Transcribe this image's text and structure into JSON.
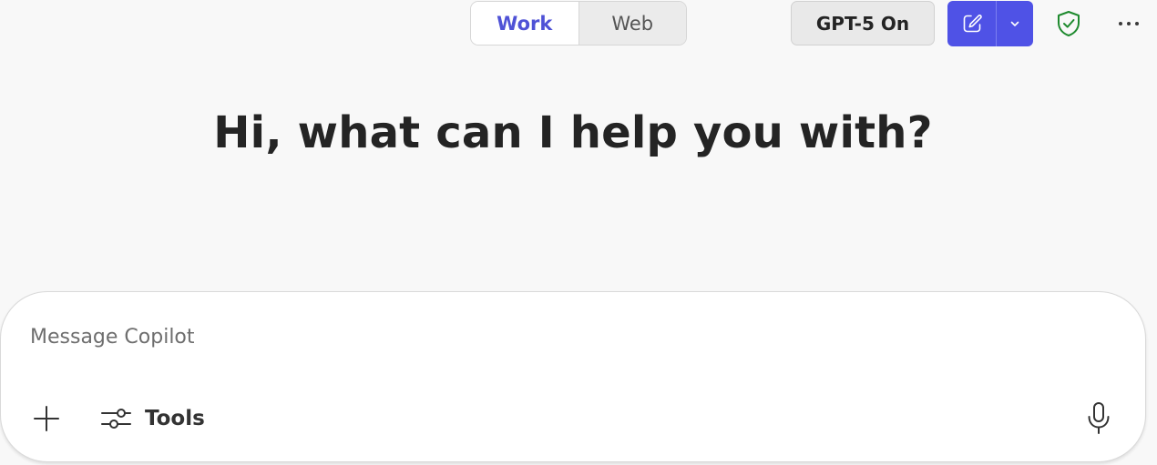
{
  "header": {
    "mode_toggle": {
      "work_label": "Work",
      "web_label": "Web",
      "active": "Work"
    },
    "model_button_label": "GPT-5 On",
    "new_chat_icon": "compose-icon",
    "new_chat_dropdown_icon": "chevron-down-icon",
    "protection_icon": "shield-check-icon",
    "more_icon": "more-horizontal-icon"
  },
  "main": {
    "greeting": "Hi, what can I help you with?"
  },
  "composer": {
    "placeholder": "Message Copilot",
    "value": "",
    "add_icon": "plus-icon",
    "tools_label": "Tools",
    "tools_icon": "sliders-icon",
    "mic_icon": "microphone-icon"
  },
  "colors": {
    "accent": "#4f52e6",
    "active_tab_text": "#4f52d6",
    "shield_green": "#1e8a2e",
    "background": "#f8f8f8"
  }
}
